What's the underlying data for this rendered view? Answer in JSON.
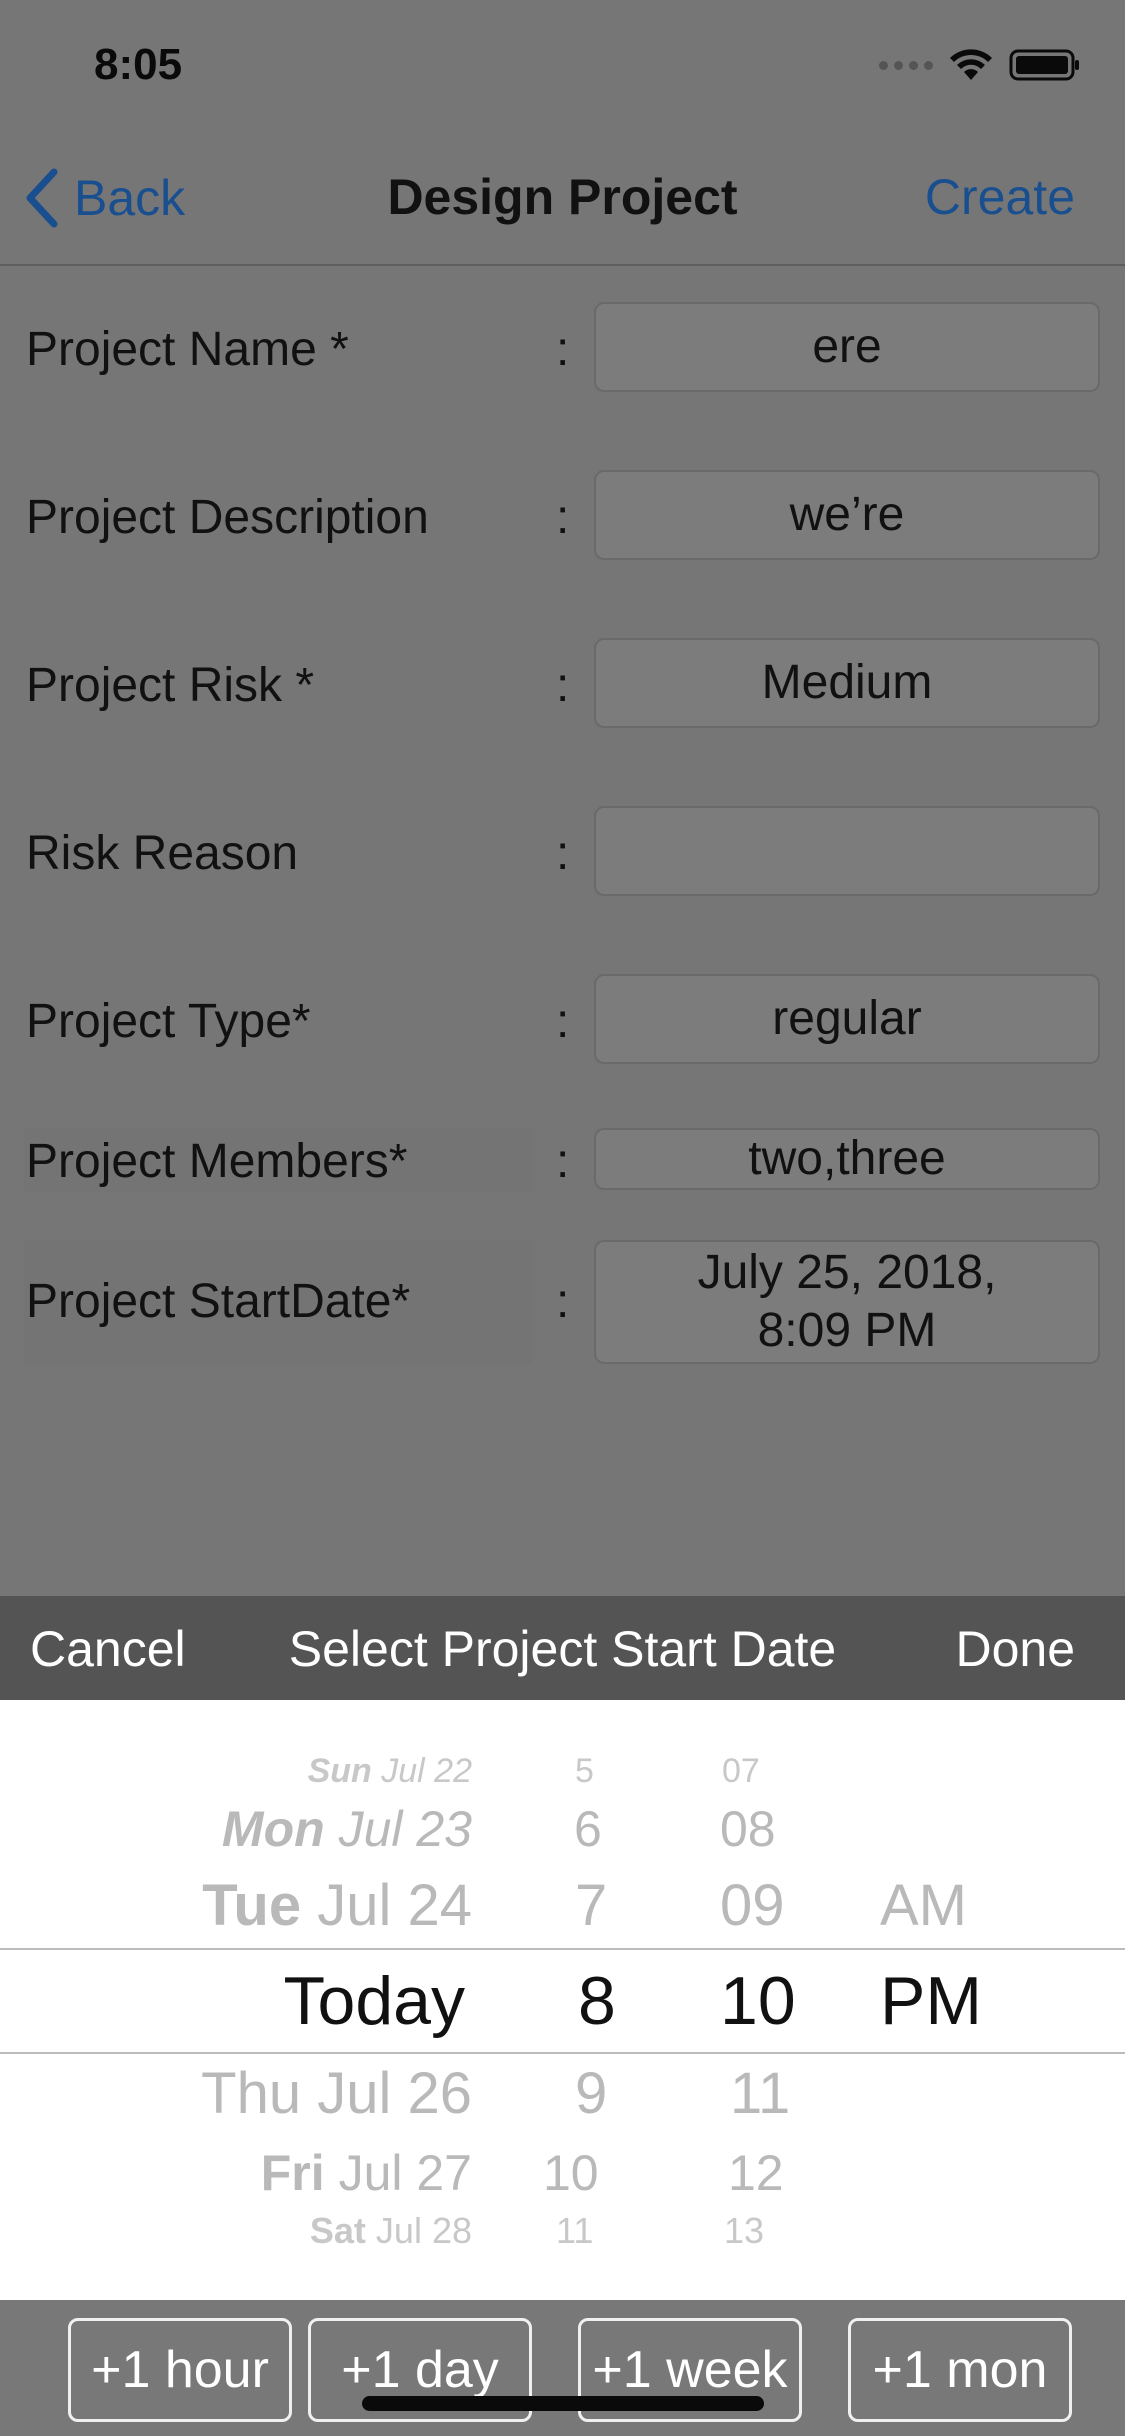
{
  "status_bar": {
    "time": "8:05"
  },
  "nav": {
    "back_label": "Back",
    "title": "Design Project",
    "create_label": "Create",
    "accent": "#1a4f8f"
  },
  "form": {
    "rows": [
      {
        "label": "Project Name *",
        "colon": ":",
        "value": "ere"
      },
      {
        "label": "Project Description",
        "colon": ":",
        "value": "we’re"
      },
      {
        "label": "Project Risk *",
        "colon": ":",
        "value": "Medium"
      },
      {
        "label": "Risk Reason",
        "colon": ":",
        "value": ""
      },
      {
        "label": "Project Type*",
        "colon": ":",
        "value": "regular"
      },
      {
        "label": "Project Members*",
        "colon": ":",
        "value": "two,three"
      },
      {
        "label": "Project StartDate*",
        "colon": ":",
        "value_line1": "July 25, 2018,",
        "value_line2": "8:09 PM"
      }
    ]
  },
  "picker_toolbar": {
    "cancel_label": "Cancel",
    "title": "Select Project Start Date",
    "done_label": "Done"
  },
  "picker": {
    "date_column": {
      "above": [
        {
          "day": "Sun",
          "date": "Jul 22"
        },
        {
          "day": "Mon",
          "date": "Jul 23"
        },
        {
          "day": "Tue",
          "date": "Jul 24"
        }
      ],
      "selected": "Today",
      "below": [
        {
          "day": "Thu",
          "date": "Jul 26"
        },
        {
          "day": "Fri",
          "date": "Jul 27"
        },
        {
          "day": "Sat",
          "date": "Jul 28"
        }
      ]
    },
    "hour_column": {
      "above": [
        "5",
        "6",
        "7"
      ],
      "selected": "8",
      "below": [
        "9",
        "10",
        "11"
      ]
    },
    "minute_column": {
      "above": [
        "07",
        "08",
        "09"
      ],
      "selected": "10",
      "below": [
        "11",
        "12",
        "13"
      ]
    },
    "ampm_column": {
      "above": [
        "AM"
      ],
      "selected": "PM"
    }
  },
  "quick_buttons": [
    "+1 hour",
    "+1 day",
    "+1 week",
    "+1 mon"
  ]
}
